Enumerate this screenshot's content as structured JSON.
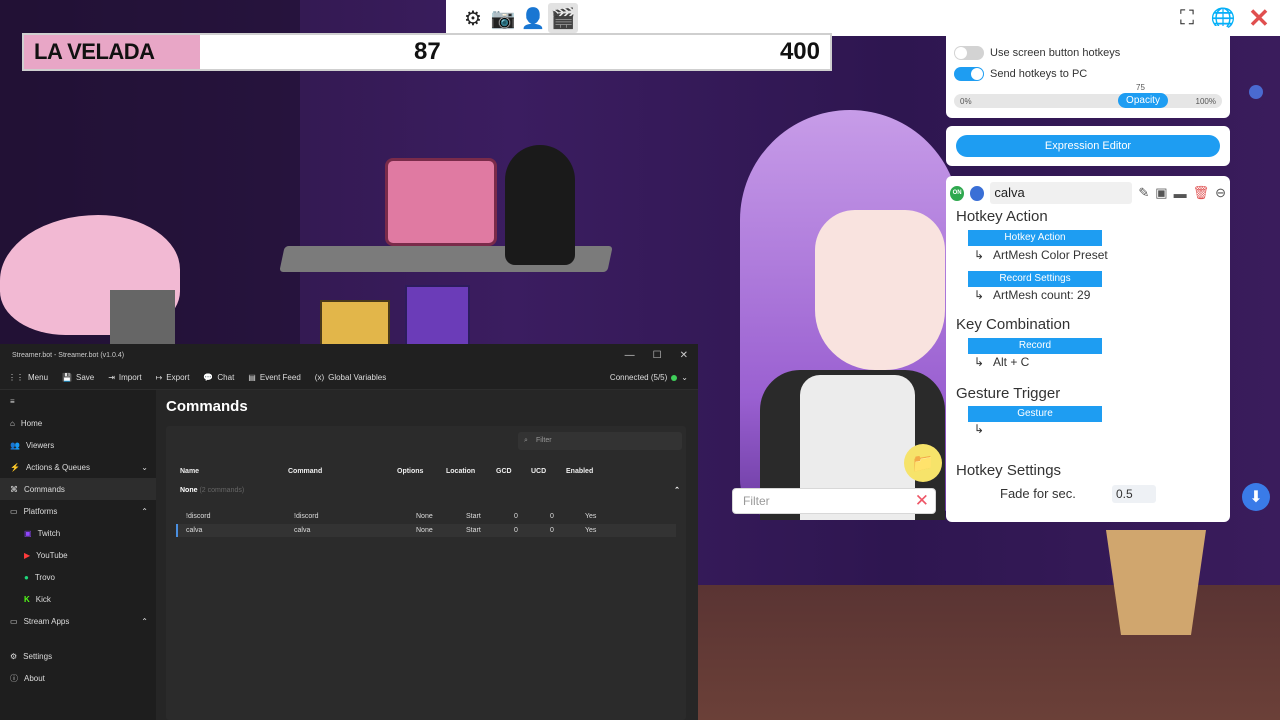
{
  "topbar": {
    "icons": [
      "gear-icon",
      "camera-icon",
      "add-person-icon",
      "clapperboard-icon"
    ],
    "right_icons": [
      "fullscreen-icon",
      "translate-icon",
      "close-icon"
    ]
  },
  "scorebar": {
    "label": "LA VELADA",
    "value_a": "87",
    "value_b": "400"
  },
  "hotkey_toggles": [
    {
      "label": "Use screen button hotkeys",
      "on": false
    },
    {
      "label": "Send hotkeys to PC",
      "on": true
    }
  ],
  "opacity": {
    "label": "Opacity",
    "value": "75",
    "min": "0%",
    "max": "100%"
  },
  "expression_editor": {
    "label": "Expression Editor"
  },
  "hotkey": {
    "name": "calva",
    "on_badge": "ON",
    "sections": {
      "action_title": "Hotkey Action",
      "action_button": "Hotkey Action",
      "action_value": "ArtMesh Color Preset",
      "record_settings_button": "Record Settings",
      "record_settings_value": "ArtMesh count: 29",
      "key_combo_title": "Key Combination",
      "record_button": "Record",
      "key_combo_value": "Alt + C",
      "gesture_title": "Gesture Trigger",
      "gesture_button": "Gesture",
      "settings_title": "Hotkey Settings",
      "fade_label": "Fade for sec.",
      "fade_value": "0.5"
    }
  },
  "filter_placeholder": "Filter",
  "streamerbot": {
    "title": "Streamer.bot - Streamer.bot (v1.0.4)",
    "menu": [
      "Menu",
      "Save",
      "Import",
      "Export",
      "Chat",
      "Event Feed",
      "Global Variables"
    ],
    "connection": "Connected (5/5)",
    "sidebar": [
      {
        "label": "Home",
        "sub": false
      },
      {
        "label": "Viewers",
        "sub": false
      },
      {
        "label": "Actions & Queues",
        "sub": false,
        "caret": "⌄"
      },
      {
        "label": "Commands",
        "sub": false,
        "active": true
      },
      {
        "label": "Platforms",
        "sub": false,
        "caret": "⌃"
      },
      {
        "label": "Twitch",
        "sub": true
      },
      {
        "label": "YouTube",
        "sub": true
      },
      {
        "label": "Trovo",
        "sub": true
      },
      {
        "label": "Kick",
        "sub": true
      },
      {
        "label": "Stream Apps",
        "sub": false,
        "caret": "⌃"
      },
      {
        "label": "Settings",
        "sub": false
      },
      {
        "label": "About",
        "sub": false
      }
    ],
    "page_title": "Commands",
    "filter_placeholder": "Filter",
    "columns": [
      "Name",
      "Command",
      "Options",
      "Location",
      "GCD",
      "UCD",
      "Enabled"
    ],
    "group": {
      "name": "None",
      "count": "(2 commands)"
    },
    "rows": [
      {
        "name": "!discord",
        "command": "!discord",
        "options": "None",
        "location": "Start",
        "gcd": "0",
        "ucd": "0",
        "enabled": "Yes"
      },
      {
        "name": "calva",
        "command": "calva",
        "options": "None",
        "location": "Start",
        "gcd": "0",
        "ucd": "0",
        "enabled": "Yes"
      }
    ]
  }
}
